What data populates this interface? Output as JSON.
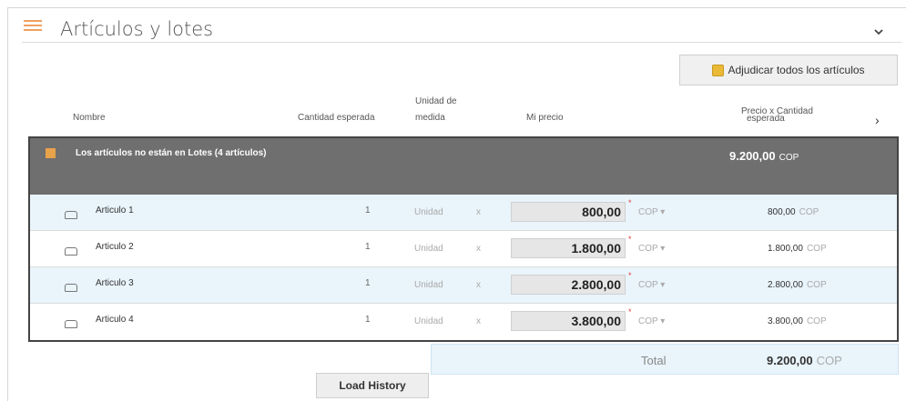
{
  "section": {
    "title": "Artículos y lotes"
  },
  "actions": {
    "adjudicar_label": "Adjudicar todos los artículos",
    "load_history_label": "Load History"
  },
  "columns": {
    "nombre": "Nombre",
    "cantidad": "Cantidad esperada",
    "unidad_line1": "Unidad de",
    "unidad_line2": "medida",
    "precio": "Mi precio",
    "total_line1": "Precio x Cantidad",
    "total_line2": "esperada"
  },
  "group": {
    "label": "Los artículos no están en Lotes (4 artículos)",
    "total": "9.200,00",
    "currency": "COP"
  },
  "rows": [
    {
      "name": "Articulo 1",
      "qty": "1",
      "unit": "Unidad",
      "x": "x",
      "price": "800,00",
      "currency": "COP ▾",
      "total": "800,00",
      "total_currency": "COP"
    },
    {
      "name": "Articulo 2",
      "qty": "1",
      "unit": "Unidad",
      "x": "x",
      "price": "1.800,00",
      "currency": "COP ▾",
      "total": "1.800,00",
      "total_currency": "COP"
    },
    {
      "name": "Articulo 3",
      "qty": "1",
      "unit": "Unidad",
      "x": "x",
      "price": "2.800,00",
      "currency": "COP ▾",
      "total": "2.800,00",
      "total_currency": "COP"
    },
    {
      "name": "Articulo 4",
      "qty": "1",
      "unit": "Unidad",
      "x": "x",
      "price": "3.800,00",
      "currency": "COP ▾",
      "total": "3.800,00",
      "total_currency": "COP"
    }
  ],
  "summary": {
    "label": "Total",
    "value": "9.200,00",
    "currency": "COP"
  },
  "required_mark": "*",
  "icons": {
    "menu": "list-icon",
    "collapse": "chevron-down-icon",
    "next": "chevron-right-icon",
    "group": "grid-icon",
    "row": "item-icon",
    "award": "award-cup-icon"
  },
  "colors": {
    "accent": "#f0a060",
    "group_bg": "#6f6f6f",
    "row_alt": "#e9f4fb",
    "required": "#e04040"
  }
}
